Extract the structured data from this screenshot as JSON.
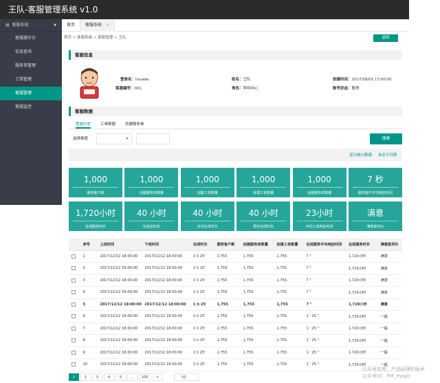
{
  "app": {
    "title": "王队-客服管理系统 v1.0"
  },
  "sidebar": {
    "group": "客服系统",
    "items": [
      {
        "label": "客服操作台"
      },
      {
        "label": "信息查询"
      },
      {
        "label": "服务单管理"
      },
      {
        "label": "工单管理"
      },
      {
        "label": "客服管理"
      },
      {
        "label": "客服监控"
      }
    ],
    "active_index": 4
  },
  "tabs": [
    {
      "label": "首页"
    },
    {
      "label": "客服系统"
    }
  ],
  "breadcrumb": "首页 > 客服系统 > 客服管理 > 王队",
  "back_label": "返回",
  "profile": {
    "section_title": "客服信息",
    "login_name_label": "登录名：",
    "login_name": "lixueke",
    "staff_id_label": "客服编号：",
    "staff_id": "001",
    "name_label": "姓名：",
    "name": "王队",
    "role_label": "角色：",
    "role": "呼叫中心",
    "created_label": "创建时间：",
    "created": "2017/09/01 17:00:00",
    "account_status_label": "账号状态：",
    "account_status": "暂停"
  },
  "data_section": {
    "title": "客服数据",
    "subtabs": [
      {
        "label": "登录历史"
      },
      {
        "label": "工单数据"
      },
      {
        "label": "创建服务单"
      }
    ],
    "filter_label": "选择维度",
    "search_label": "搜索",
    "link_stats": "显示统计数据",
    "link_custom": "自定义列表"
  },
  "cards": [
    {
      "value": "1,000",
      "label": "服务客户数"
    },
    {
      "value": "1,000",
      "label": "创建服务单数量"
    },
    {
      "value": "1,000",
      "label": "创建工单数量"
    },
    {
      "value": "1,000",
      "label": "处理工单数量"
    },
    {
      "value": "1,000",
      "label": "创建服务单数量"
    },
    {
      "value": "7 秒",
      "label": "服务客户平均响应时间"
    },
    {
      "value": "1,720小时",
      "label": "在线服务时长"
    },
    {
      "value": "40 小时",
      "label": "在线总时长"
    },
    {
      "value": "40 小时",
      "label": "日均在线时长"
    },
    {
      "value": "40 小时",
      "label": "周均在线时长"
    },
    {
      "value": "23小时",
      "label": "平均工单响应时间"
    },
    {
      "value": "满意",
      "label": "满意度评价"
    }
  ],
  "table": {
    "headers": [
      "序号",
      "上线时间",
      "下线时间",
      "在线时长",
      "服务客户数",
      "创建服务单数量",
      "创建工单数量",
      "在线服务平均响应时间",
      "在线服务时长",
      "满意度评价"
    ],
    "rows": [
      [
        "1",
        "2017/12/12 18:00:00",
        "2017/12/12 18:00:00",
        "1 h 25'",
        "1,755",
        "1,755",
        "1,755",
        "7 \"",
        "1,720小时",
        "满意"
      ],
      [
        "2",
        "2017/12/12 18:00:00",
        "2017/12/12 18:00:00",
        "1 h 25'",
        "1,755",
        "1,755",
        "1,755",
        "7 \"",
        "1,720小时",
        "满意"
      ],
      [
        "3",
        "2017/12/12 18:00:00",
        "2017/12/12 18:00:00",
        "1 h 25'",
        "1,755",
        "1,755",
        "1,755",
        "7 \"",
        "1,720小时",
        "满意"
      ],
      [
        "4",
        "2017/12/12 18:00:00",
        "2017/12/12 18:00:00",
        "1 h 25'",
        "1,755",
        "1,755",
        "1,755",
        "7 \"",
        "1,720小时",
        "满意"
      ],
      [
        "5",
        "2017/12/12 18:00:00",
        "2017/12/12 18:00:00",
        "1 h 25'",
        "1,755",
        "1,755",
        "1,755",
        "7 \"",
        "1,720小时",
        "满意"
      ],
      [
        "6",
        "2017/12/12 18:00:00",
        "2017/12/12 18:00:00",
        "1 h 25'",
        "1,755",
        "1,755",
        "1,755",
        "1 ' 25 \"",
        "1,720小时",
        "一般"
      ],
      [
        "7",
        "2017/12/12 18:00:00",
        "2017/12/12 18:00:00",
        "1 h 25'",
        "1,755",
        "1,755",
        "1,755",
        "1 ' 25 \"",
        "1,720小时",
        "一般"
      ],
      [
        "8",
        "2017/12/12 18:00:00",
        "2017/12/12 18:00:00",
        "1 h 25'",
        "1,755",
        "1,755",
        "1,755",
        "1 ' 25 \"",
        "1,720小时",
        "一般"
      ],
      [
        "9",
        "2017/12/12 18:00:00",
        "2017/12/12 18:00:00",
        "1 h 25'",
        "1,755",
        "1,755",
        "1,755",
        "1 ' 25 \"",
        "1,720小时",
        "一般"
      ],
      [
        "10",
        "2017/12/12 18:00:00",
        "2017/12/12 18:00:00",
        "1 h 25'",
        "1,755",
        "1,755",
        "1,755",
        "1 ' 25 \"",
        "1,720小时",
        "一般"
      ]
    ],
    "bold_row_index": 4
  },
  "pager": {
    "pages": [
      "1",
      "2",
      "3",
      "4",
      "5",
      "...",
      "100",
      ">"
    ],
    "active_index": 0,
    "page_size": "10"
  },
  "watermark": {
    "line1": "公众号名称：产品经理的画术",
    "line2": "公众号ID：PM_magic"
  },
  "colors": {
    "accent": "#009688",
    "card": "#26a69a",
    "sidebar": "#393d49",
    "topbar": "#2b2b2b"
  }
}
